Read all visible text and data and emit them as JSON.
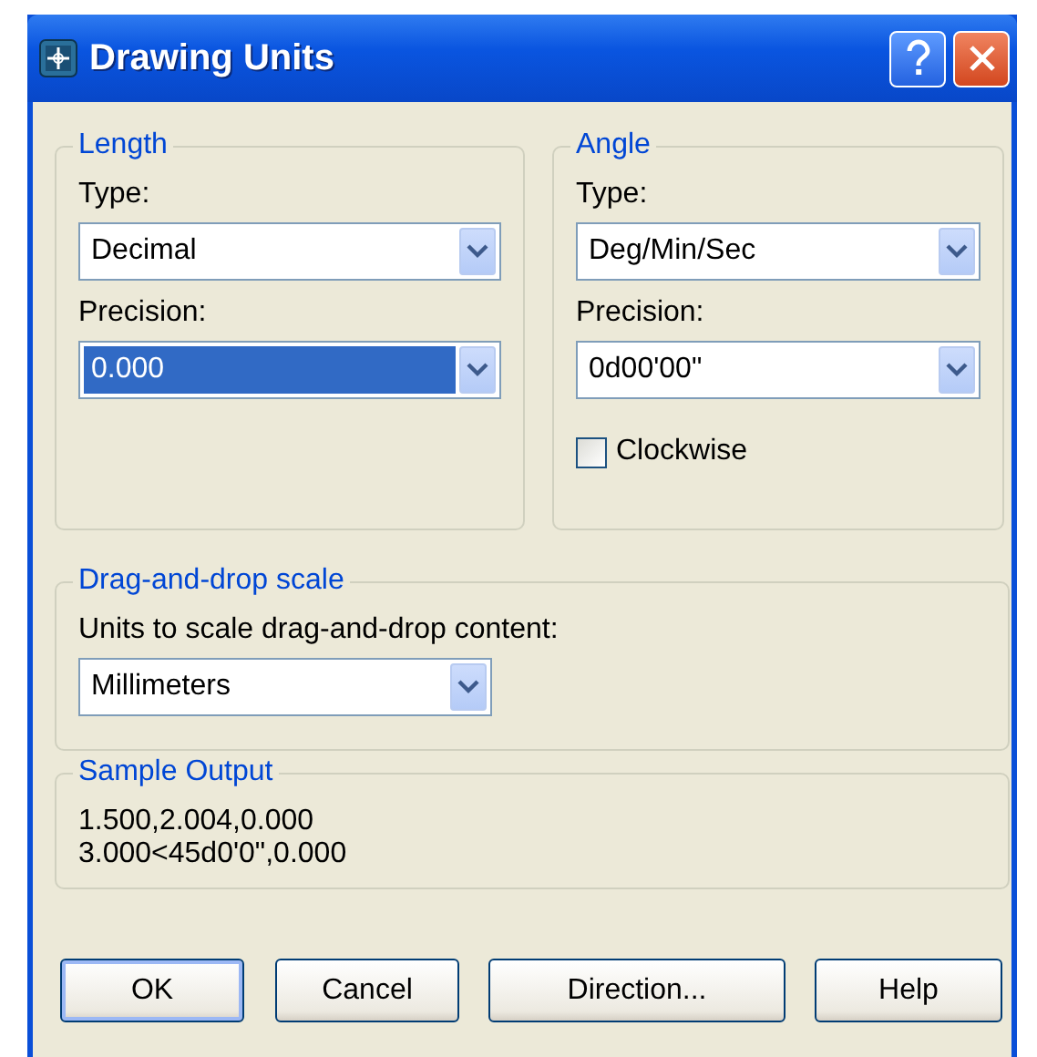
{
  "window": {
    "title": "Drawing Units"
  },
  "length": {
    "title": "Length",
    "type_label": "Type:",
    "type": {
      "value": "Decimal",
      "focused": false
    },
    "precision_label": "Precision:",
    "precision": {
      "value": "0.000",
      "focused": true
    }
  },
  "angle": {
    "title": "Angle",
    "type_label": "Type:",
    "type": {
      "value": "Deg/Min/Sec",
      "focused": false
    },
    "precision_label": "Precision:",
    "precision": {
      "value": "0d00'00\"",
      "focused": false
    },
    "clockwise": {
      "label": "Clockwise",
      "checked": false
    }
  },
  "drag_drop": {
    "title": "Drag-and-drop scale",
    "label": "Units to scale drag-and-drop content:",
    "units": {
      "value": "Millimeters",
      "focused": false
    }
  },
  "sample_output": {
    "title": "Sample Output",
    "lines": [
      "1.500,2.004,0.000",
      "3.000<45d0'0\",0.000"
    ]
  },
  "buttons": [
    {
      "label": "OK",
      "default": true
    },
    {
      "label": "Cancel",
      "default": false
    },
    {
      "label": "Direction...",
      "default": false
    },
    {
      "label": "Help",
      "default": false
    }
  ]
}
